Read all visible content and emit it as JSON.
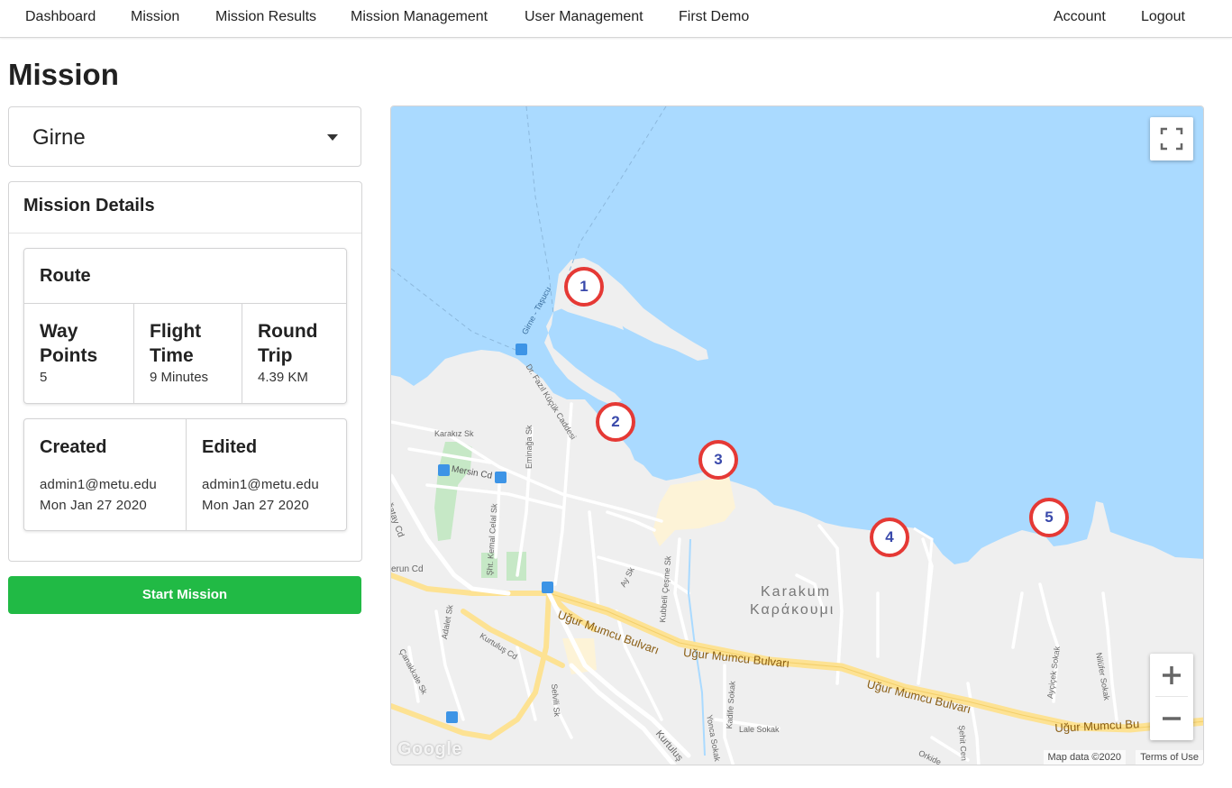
{
  "nav": {
    "left": [
      "Dashboard",
      "Mission",
      "Mission Results",
      "Mission Management",
      "User Management",
      "First Demo"
    ],
    "right": [
      "Account",
      "Logout"
    ]
  },
  "page": {
    "title": "Mission"
  },
  "mission_select": {
    "value": "Girne",
    "icon": "caret-down-icon"
  },
  "details": {
    "title": "Mission Details",
    "route": {
      "title": "Route",
      "stats": [
        {
          "label": "Way Points",
          "value": "5"
        },
        {
          "label": "Flight Time",
          "value": "9 Minutes"
        },
        {
          "label": "Round Trip",
          "value": "4.39 KM"
        }
      ]
    },
    "created": {
      "label": "Created",
      "user": "admin1@metu.edu",
      "date": "Mon Jan 27 2020"
    },
    "edited": {
      "label": "Edited",
      "user": "admin1@metu.edu",
      "date": "Mon Jan 27 2020"
    }
  },
  "actions": {
    "start_label": "Start Mission",
    "start_color": "#21ba45"
  },
  "map": {
    "water_color": "#aadaff",
    "land_color": "#efefef",
    "marker_border_color": "#e53935",
    "marker_text_color": "#3949ab",
    "waypoints": [
      "1",
      "2",
      "3",
      "4",
      "5"
    ],
    "controls": {
      "fullscreen": "fullscreen-icon",
      "zoom_in": "+",
      "zoom_out": "−"
    },
    "labels": {
      "district_latin": "Karakum",
      "district_greek": "Καράκουμι",
      "road_main_1": "Uğur Mumcu Bulvarı",
      "road_main_2": "Uğur Mumcu Bulvarı",
      "road_main_3": "Uğur Mumcu Bulvarı",
      "road_main_4": "Uğur Mumcu Bu",
      "ferry": "Girne - Taşucu",
      "fazil": "Dr. Fazıl Küçük Caddesi",
      "mersin": "Mersin Cd",
      "karakiz": "Karakız Sk",
      "eminaga": "Eminağa Sk",
      "celal": "Şht. Kemal Celal Sk",
      "cagatay": "Çağatay Cd",
      "kurtulus": "Kurtuluş Cd",
      "kurtulus2": "Kurtuluş",
      "adalet": "Adalet Sk",
      "canakkale": "Çanakkale Sk",
      "selvili": "Selvili Sk",
      "kubbeli": "Kubbeli Çeşme Sk",
      "ay": "Ay Sk",
      "kadife": "Kadife Sokak",
      "yonca": "Yonca Sokak",
      "lale": "Lale Sokak",
      "aycicek": "Ayçiçek Sokak",
      "nilufer": "Nilüfer Sokak",
      "sehit": "Şehit Cen",
      "orkide": "Orkide",
      "erun": "erun Cd"
    },
    "google": "Google",
    "map_data": "Map data ©2020",
    "terms": "Terms of Use"
  }
}
